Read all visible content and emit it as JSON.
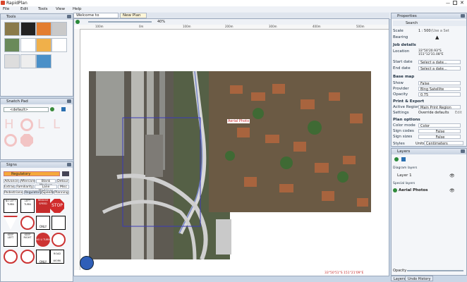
{
  "app": {
    "title": "RapidPlan"
  },
  "menu": [
    "File",
    "Edit",
    "Tools",
    "View",
    "Help"
  ],
  "doc_tabs": [
    "Welcome to RapidPlan",
    "New Plan"
  ],
  "tools_panel": {
    "title": "Tools"
  },
  "snatch_panel": {
    "title": "Snatch Pad",
    "default_value": "<default>"
  },
  "signs_panel": {
    "title": "Signs",
    "category": "Regulatory",
    "tabs_row1": [
      "Advance",
      "Aftercare",
      "Blank Markers",
      "Detour"
    ],
    "tabs_row2": [
      "Extras",
      "Familiarity",
      "Lane Markings",
      "Misc"
    ],
    "tabs_row3": [
      "Pedestrians",
      "Regulatory",
      "Speeds",
      "Planning"
    ],
    "sign_labels": [
      "NO LEFT TURN",
      "LEFT TURN",
      "REDUCE SPEED",
      "STOP",
      "GIVE WAY",
      "NO ENTRY",
      "ONLY",
      "",
      "KEEP LEFT",
      "KEEP RIGHT",
      "NO U TURN",
      "",
      "",
      "",
      "ONLY",
      "ROAD WORK"
    ]
  },
  "canvas": {
    "zoom": "40%",
    "ruler_labels": [
      "100m",
      "0m",
      "100m",
      "200m",
      "300m",
      "400m",
      "500m"
    ],
    "aerial_label": "Aerial Photo",
    "coordinates": "33°50'51\"S 151°21'09\"E"
  },
  "properties": {
    "title": "Properties",
    "search_label": "Search",
    "scale_label": "Scale",
    "scale_value": "1 : 500",
    "scale_hint": "(Use a Set",
    "bearing_label": "Bearing",
    "job_details": "Job details",
    "location_label": "Location",
    "location_value": "33°50'20.93\"S\n151°12'31.08\"E",
    "start_label": "Start date",
    "start_value": "Select a date...",
    "end_label": "End date",
    "end_value": "Select a date...",
    "base_map": "Base map",
    "show_label": "Show",
    "show_value": "False",
    "provider_label": "Provider",
    "provider_value": "Bing Satellite",
    "opacity_label": "Opacity",
    "opacity_value": "0.75",
    "print_export": "Print & Export",
    "active_region_label": "Active Region",
    "active_region_value": "Main Print Region",
    "settings_label": "Settings",
    "settings_value": "Override defaults",
    "settings_link": "Edit",
    "plan_options": "Plan options",
    "color_mode_label": "Color mode",
    "color_mode_value": "Color",
    "sign_codes_label": "Sign codes",
    "sign_codes_value": "False",
    "sign_sizes_label": "Sign sizes",
    "sign_sizes_value": "False",
    "styles_label": "Styles",
    "units_label": "Units",
    "units_value": "Centimeters"
  },
  "layers": {
    "title": "Layers",
    "diagram_layers": "Diagram layers",
    "layer1": "Layer 1",
    "special_layers": "Special layers",
    "aerial": "Aerial Photos",
    "opacity_label": "Opacity",
    "tabs": [
      "Layers",
      "Undo History"
    ]
  }
}
